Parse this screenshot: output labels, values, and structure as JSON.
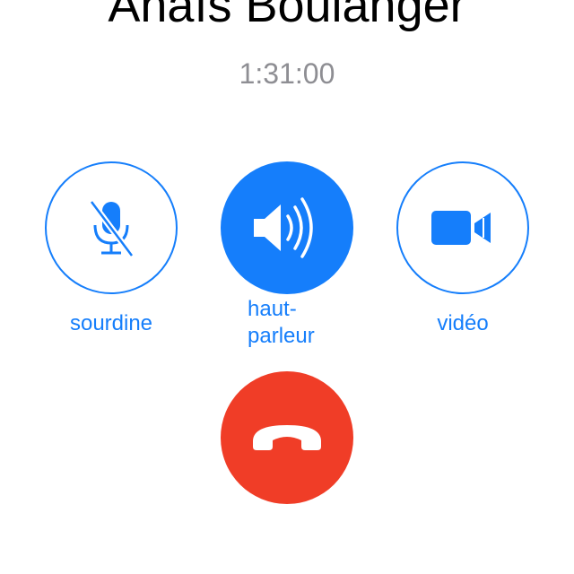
{
  "call": {
    "caller_name": "Anaïs Boulanger",
    "timer": "1:31:00"
  },
  "controls": {
    "mute": {
      "label": "sourdine",
      "icon": "microphone-slash-icon",
      "active": false
    },
    "speaker": {
      "label_line1": "haut-",
      "label_line2": "parleur",
      "icon": "speaker-icon",
      "active": true
    },
    "video": {
      "label": "vidéo",
      "icon": "video-camera-icon",
      "active": false
    }
  },
  "end_call": {
    "icon": "phone-hang-up-icon"
  },
  "colors": {
    "accent": "#157efb",
    "end_call": "#f03d27",
    "timer_text": "#8e8e93",
    "name_text": "#000000",
    "background": "#ffffff"
  }
}
